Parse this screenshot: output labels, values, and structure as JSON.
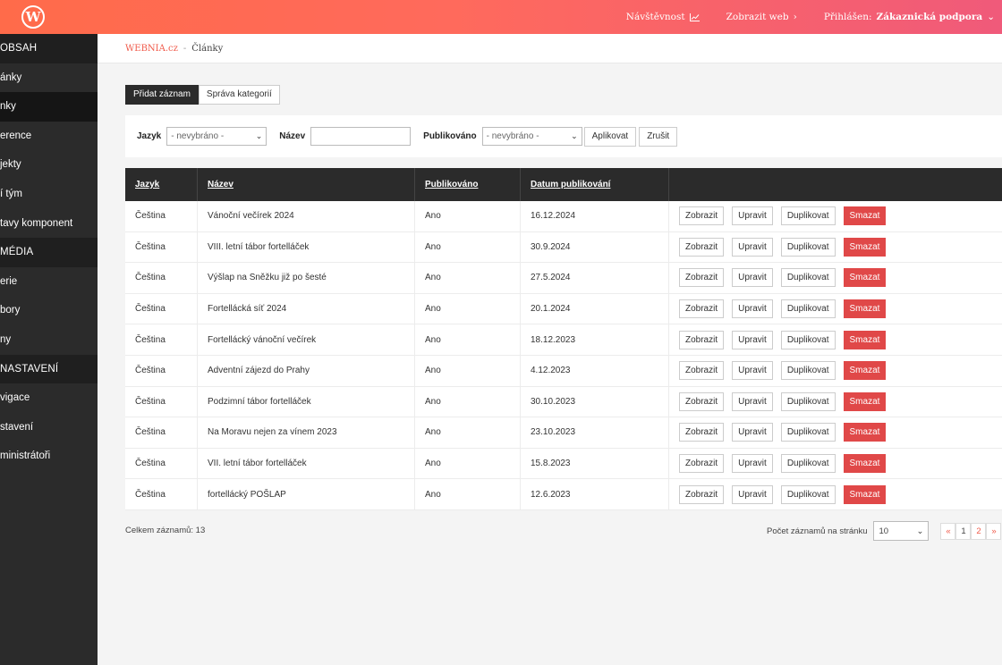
{
  "topbar": {
    "logo_letter": "W",
    "nav": {
      "traffic": "Návštěvnost",
      "view_web": "Zobrazit web",
      "logged_prefix": "Přihlášen:",
      "user": "Zákaznická podpora"
    }
  },
  "sidebar": {
    "items": [
      {
        "label": "OBSAH",
        "type": "section"
      },
      {
        "label": "ánky",
        "type": "item"
      },
      {
        "label": "nky",
        "type": "active"
      },
      {
        "label": "erence",
        "type": "item"
      },
      {
        "label": "jekty",
        "type": "item"
      },
      {
        "label": "í tým",
        "type": "item"
      },
      {
        "label": "tavy komponent",
        "type": "item"
      },
      {
        "label": "MÉDIA",
        "type": "section"
      },
      {
        "label": "erie",
        "type": "item"
      },
      {
        "label": "bory",
        "type": "item"
      },
      {
        "label": "ny",
        "type": "item"
      },
      {
        "label": "NASTAVENÍ",
        "type": "section"
      },
      {
        "label": "vigace",
        "type": "item"
      },
      {
        "label": "stavení",
        "type": "item"
      },
      {
        "label": "ministrátoři",
        "type": "item"
      }
    ]
  },
  "breadcrumb": {
    "home": "WEBNIA.cz",
    "separator": "-",
    "current": "Články"
  },
  "actions": {
    "add": "Přidat záznam",
    "categories": "Správa kategorií"
  },
  "filter": {
    "lang_label": "Jazyk",
    "lang_value": "- nevybráno -",
    "name_label": "Název",
    "name_value": "",
    "published_label": "Publikováno",
    "published_value": "- nevybráno -",
    "apply": "Aplikovat",
    "cancel": "Zrušit"
  },
  "table": {
    "headers": [
      "Jazyk",
      "Název",
      "Publikováno",
      "Datum publikování"
    ],
    "row_actions": {
      "view": "Zobrazit",
      "edit": "Upravit",
      "duplicate": "Duplikovat",
      "delete": "Smazat"
    },
    "rows": [
      {
        "lang": "Čeština",
        "name": "Vánoční večírek 2024",
        "published": "Ano",
        "date": "16.12.2024"
      },
      {
        "lang": "Čeština",
        "name": "VIII. letní tábor fortelláček",
        "published": "Ano",
        "date": "30.9.2024"
      },
      {
        "lang": "Čeština",
        "name": "Výšlap na Sněžku již po šesté",
        "published": "Ano",
        "date": "27.5.2024"
      },
      {
        "lang": "Čeština",
        "name": "Fortellácká síť 2024",
        "published": "Ano",
        "date": "20.1.2024"
      },
      {
        "lang": "Čeština",
        "name": "Fortellácký vánoční večírek",
        "published": "Ano",
        "date": "18.12.2023"
      },
      {
        "lang": "Čeština",
        "name": "Adventní zájezd do Prahy",
        "published": "Ano",
        "date": "4.12.2023"
      },
      {
        "lang": "Čeština",
        "name": "Podzimní tábor fortelláček",
        "published": "Ano",
        "date": "30.10.2023"
      },
      {
        "lang": "Čeština",
        "name": "Na Moravu nejen za vínem 2023",
        "published": "Ano",
        "date": "23.10.2023"
      },
      {
        "lang": "Čeština",
        "name": "VII. letní tábor fortelláček",
        "published": "Ano",
        "date": "15.8.2023"
      },
      {
        "lang": "Čeština",
        "name": "fortellácký POŠLAP",
        "published": "Ano",
        "date": "12.6.2023"
      }
    ]
  },
  "footer": {
    "total": "Celkem záznamů: 13",
    "per_page_label": "Počet záznamů na stránku",
    "per_page_value": "10",
    "pages": {
      "prev": "«",
      "p1": "1",
      "p2": "2",
      "next": "»"
    }
  }
}
